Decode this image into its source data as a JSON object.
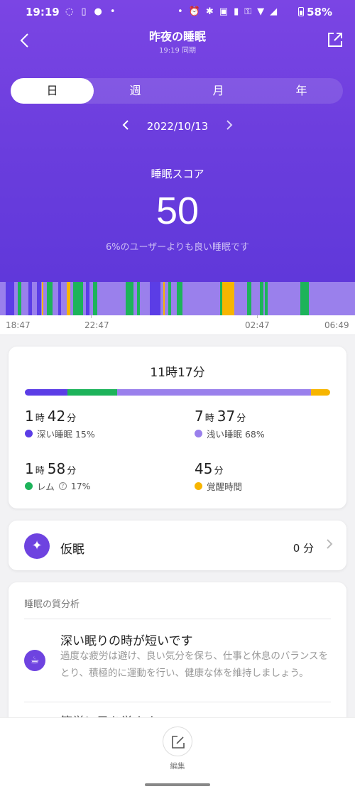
{
  "status_bar": {
    "time": "19:19",
    "battery": "58%"
  },
  "header": {
    "title": "昨夜の睡眠",
    "subtitle": "19:19 同期",
    "tabs": [
      "日",
      "週",
      "月",
      "年"
    ],
    "active_tab": 0,
    "date": "2022/10/13",
    "score_label": "睡眠スコア",
    "score": "50",
    "score_desc": "6%のユーザーよりも良い睡眠です"
  },
  "timeline": {
    "axis_labels": [
      "18:47",
      "22:47",
      "02:47",
      "06:49"
    ],
    "colors": {
      "deep": "#5b3de6",
      "light": "#9a80ec",
      "rem": "#1db35a",
      "awake": "#f7b500"
    }
  },
  "summary": {
    "total": "11時17分",
    "deep": {
      "h": "1",
      "h_unit": "時",
      "m": "42",
      "m_unit": "分",
      "label": "深い睡眠 15%"
    },
    "light": {
      "h": "7",
      "h_unit": "時",
      "m": "37",
      "m_unit": "分",
      "label": "浅い睡眠 68%"
    },
    "rem": {
      "h": "1",
      "h_unit": "時",
      "m": "58",
      "m_unit": "分",
      "label": "レム",
      "help": "?",
      "pct": "17%"
    },
    "awake": {
      "m": "45",
      "m_unit": "分",
      "label": "覚醒時間"
    }
  },
  "nap": {
    "label": "仮眠",
    "value": "0 分"
  },
  "analysis": {
    "title": "睡眠の質分析",
    "item1_title": "深い眠りの時が短いです",
    "item1_body": "過度な疲労は避け、良い気分を保ち、仕事と休息のバランスをとり、積極的に運動を行い、健康な体を維持しましょう。",
    "item2_title": "簡単に目を覚ます"
  },
  "bottom": {
    "edit_label": "編集"
  }
}
